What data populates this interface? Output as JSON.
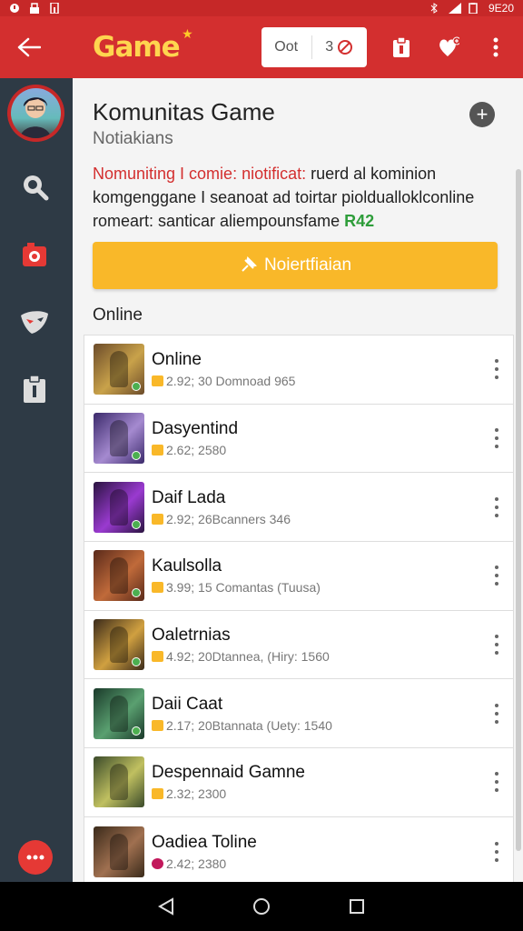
{
  "statusbar": {
    "time": "9E20"
  },
  "appbar": {
    "logo_text": "Game",
    "search_value": "Oot",
    "count": "3"
  },
  "main": {
    "title": "Komunitas Game",
    "subtitle": "Notiakians",
    "notice_red": "Nomuniting I comie: niotificat:",
    "notice_rest1": " ruerd al kominion komgenggane I seanoat ad toirtar pioldualloklconline romeart: santicar aliempounsfame ",
    "notice_green": "R42",
    "notify_button": "Noiertfiaian",
    "section_label": "Online"
  },
  "games": [
    {
      "name": "Online",
      "meta": "2.92; 30 Domnoad 965",
      "coin": "gold",
      "colors": [
        "#6b4b2a",
        "#c9a24a"
      ]
    },
    {
      "name": "Dasyentind",
      "meta": "2.62; 2580",
      "coin": "gold",
      "colors": [
        "#3b2a6b",
        "#a58ad0"
      ]
    },
    {
      "name": "Daif Lada",
      "meta": "2.92; 26Bcanners 346",
      "coin": "gold",
      "colors": [
        "#2a1440",
        "#9a3ad0"
      ]
    },
    {
      "name": "Kaulsolla",
      "meta": "3.99; 15 Comantas (Tuusa)",
      "coin": "gold",
      "colors": [
        "#5a2a1a",
        "#c06a3a"
      ]
    },
    {
      "name": "Oaletrnias",
      "meta": "4.92; 20Dtannea, (Hiry: 1560",
      "coin": "gold",
      "colors": [
        "#3a2a1a",
        "#d0a040"
      ]
    },
    {
      "name": "Daii Caat",
      "meta": "2.17; 20Btannata (Uety: 1540",
      "coin": "gold",
      "colors": [
        "#1a3a2a",
        "#5aa070"
      ]
    },
    {
      "name": "Despennaid Gamne",
      "meta": "2.32; 2300",
      "coin": "gold",
      "colors": [
        "#3a4a2a",
        "#c0c060"
      ]
    },
    {
      "name": "Oadiea Toline",
      "meta": "2.42; 2380",
      "coin": "pink",
      "colors": [
        "#3a2a1a",
        "#a07050"
      ]
    }
  ],
  "colors": {
    "accent": "#d32f2f",
    "sidebar": "#2e3a45",
    "button": "#f9b829"
  }
}
